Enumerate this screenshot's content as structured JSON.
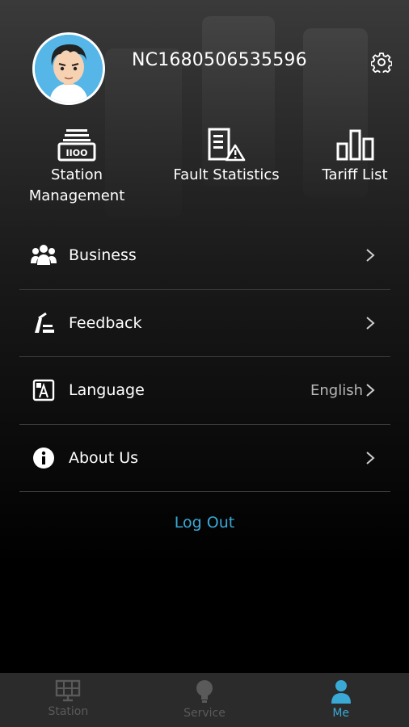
{
  "header": {
    "username": "NC1680506535596"
  },
  "quick_actions": [
    {
      "label_line1": "Station",
      "label_line2": "Management",
      "icon": "station-management-icon"
    },
    {
      "label_line1": "Fault Statistics",
      "icon": "fault-statistics-icon"
    },
    {
      "label_line1": "Tariff List",
      "icon": "tariff-list-icon"
    }
  ],
  "menu": [
    {
      "label": "Business",
      "icon": "business-icon",
      "value": ""
    },
    {
      "label": "Feedback",
      "icon": "feedback-icon",
      "value": ""
    },
    {
      "label": "Language",
      "icon": "language-icon",
      "value": "English"
    },
    {
      "label": "About Us",
      "icon": "info-icon",
      "value": ""
    }
  ],
  "logout_label": "Log Out",
  "tabbar": [
    {
      "label": "Station",
      "icon": "solar-panel-icon",
      "active": false
    },
    {
      "label": "Service",
      "icon": "lightbulb-icon",
      "active": false
    },
    {
      "label": "Me",
      "icon": "person-icon",
      "active": true
    }
  ],
  "colors": {
    "accent": "#3aa9d6",
    "inactive_tab": "#5a5a5a",
    "divider": "#3a3a3a",
    "tabbar_bg": "#2b2b2b"
  }
}
